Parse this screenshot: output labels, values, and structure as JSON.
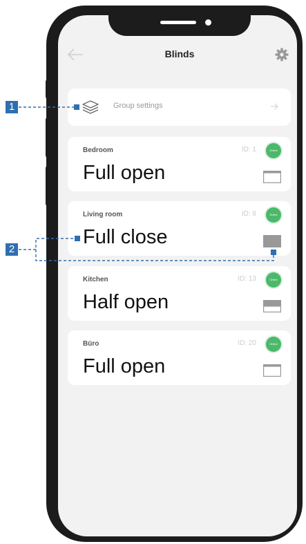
{
  "header": {
    "title": "Blinds",
    "back_icon": "arrow-left-icon",
    "settings_icon": "gear-icon"
  },
  "group_settings": {
    "label": "Group settings",
    "icon": "layers-icon",
    "arrow_icon": "arrow-right-icon"
  },
  "blinds": [
    {
      "room": "Bedroom",
      "id": "ID: 1",
      "status": "Online",
      "state": "Full open",
      "level": "open"
    },
    {
      "room": "Living room",
      "id": "ID: 8",
      "status": "Online",
      "state": "Full close",
      "level": "closed"
    },
    {
      "room": "Kitchen",
      "id": "ID: 13",
      "status": "Online",
      "state": "Half open",
      "level": "half"
    },
    {
      "room": "Büro",
      "id": "ID: 20",
      "status": "Online",
      "state": "Full open",
      "level": "open"
    }
  ],
  "annotations": [
    "1",
    "2"
  ],
  "colors": {
    "accent": "#2f6fb0",
    "online": "#4cb86a",
    "frame": "#1c1c1c",
    "screen_bg": "#f2f2f2"
  }
}
